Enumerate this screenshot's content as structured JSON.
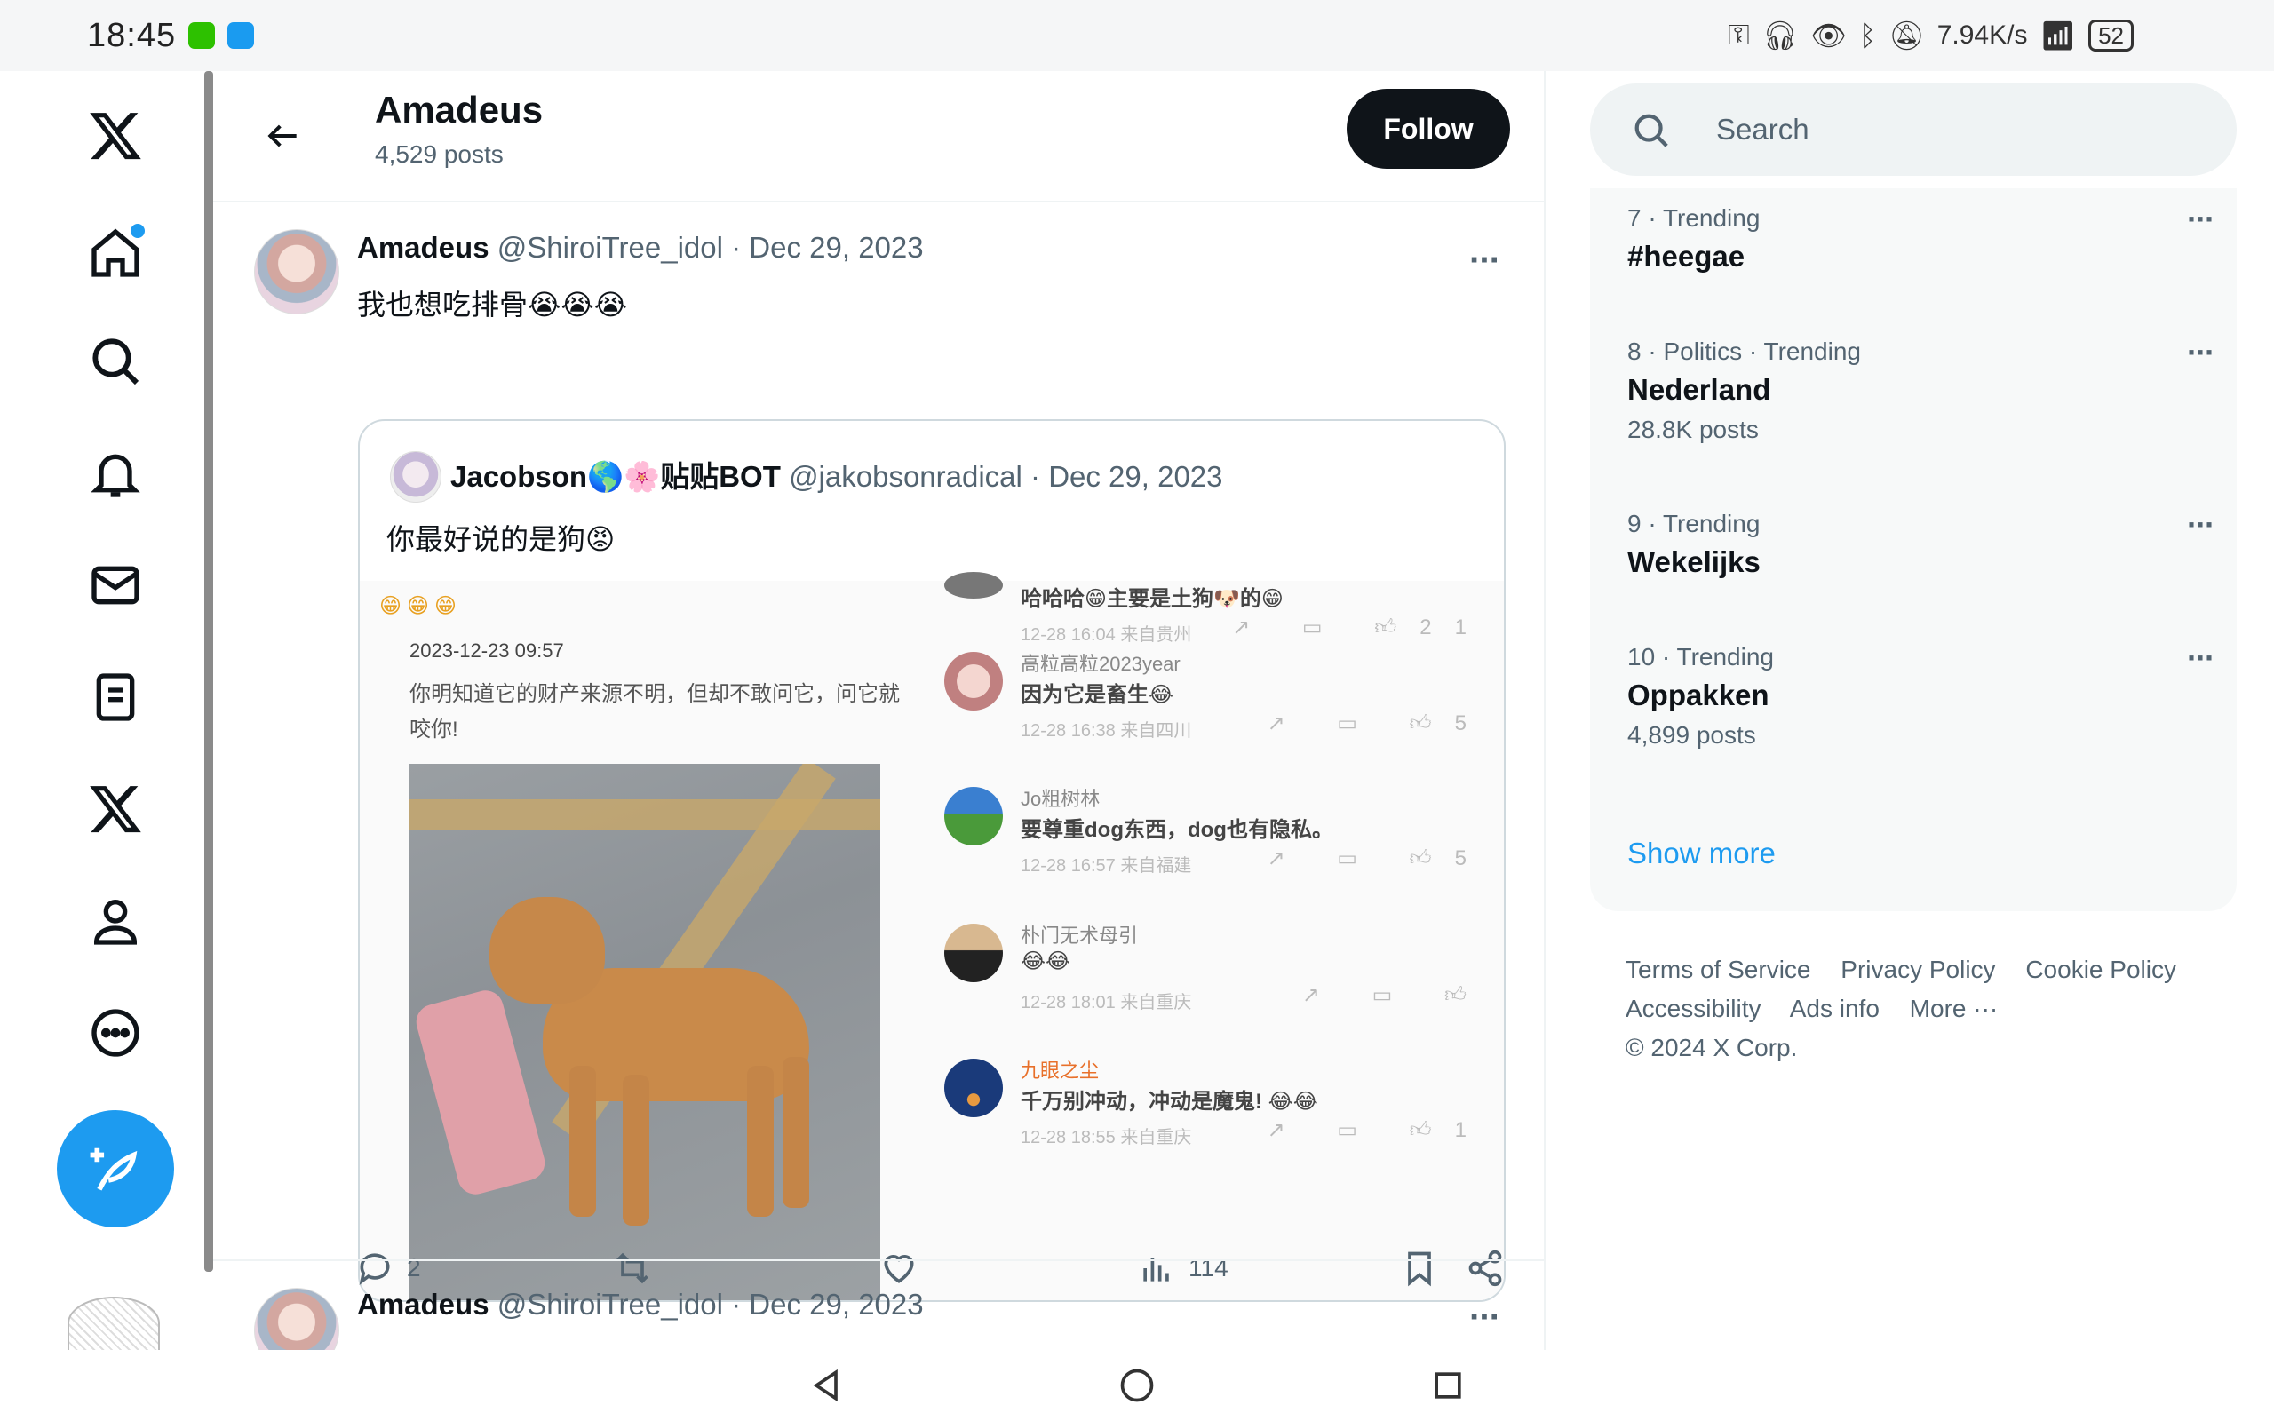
{
  "status_bar": {
    "time": "18:45",
    "network_speed": "7.94K/s",
    "battery": "52",
    "icons": [
      "key-icon",
      "headphones-icon",
      "eye-icon",
      "bluetooth-icon",
      "mute-icon",
      "wifi-icon"
    ]
  },
  "header": {
    "title": "Amadeus",
    "posts_count": "4,529 posts",
    "follow_label": "Follow"
  },
  "tweet1": {
    "name": "Amadeus",
    "handle": "@ShiroiTree_idol",
    "date": "· Dec 29, 2023",
    "text": "我也想吃排骨😭😭😭",
    "quote": {
      "name": "Jacobson🌎🌸贴贴BOT",
      "handle": "@jakobsonradical",
      "date": "· Dec 29, 2023",
      "text": "你最好说的是狗😡",
      "image": {
        "left_emojis": "😁😁😁",
        "left_date": "2023-12-23 09:57",
        "left_body": "你明知道它的财产来源不明，但却不敢问它，问它就咬你!",
        "comments": [
          {
            "name": "",
            "text": "哈哈哈😁主要是土狗🐶的😁",
            "time": "12-28 16:04 来自贵州",
            "likes": "21"
          },
          {
            "name": "高粒高粒2023year",
            "text": "因为它是畜生😂",
            "time": "12-28 16:38 来自四川",
            "likes": "5"
          },
          {
            "name": "Jo粗树林",
            "text": "要尊重dog东西，dog也有隐私。",
            "time": "12-28 16:57 来自福建",
            "likes": "5"
          },
          {
            "name": "朴门无术母引",
            "text": "😂😂",
            "time": "12-28 18:01 来自重庆",
            "likes": ""
          },
          {
            "name": "九眼之尘",
            "text": "千万别冲动，冲动是魔鬼! 😂😂",
            "time": "12-28 18:55 来自重庆",
            "likes": "1"
          }
        ]
      }
    },
    "replies": "2",
    "views": "114"
  },
  "tweet2": {
    "name": "Amadeus",
    "handle": "@ShiroiTree_idol",
    "date": "· Dec 29, 2023"
  },
  "search": {
    "placeholder": "Search"
  },
  "trends": [
    {
      "meta": "7 · Trending",
      "name": "#heegae",
      "posts": ""
    },
    {
      "meta": "8 · Politics · Trending",
      "name": "Nederland",
      "posts": "28.8K posts"
    },
    {
      "meta": "9 · Trending",
      "name": "Wekelijks",
      "posts": ""
    },
    {
      "meta": "10 · Trending",
      "name": "Oppakken",
      "posts": "4,899 posts"
    }
  ],
  "show_more": "Show more",
  "footer": {
    "terms": "Terms of Service",
    "privacy": "Privacy Policy",
    "cookie": "Cookie Policy",
    "accessibility": "Accessibility",
    "ads": "Ads info",
    "more": "More ···",
    "copyright": "© 2024 X Corp."
  },
  "colors": {
    "accent": "#1d9bf0",
    "text": "#0f1419",
    "muted": "#536471"
  }
}
